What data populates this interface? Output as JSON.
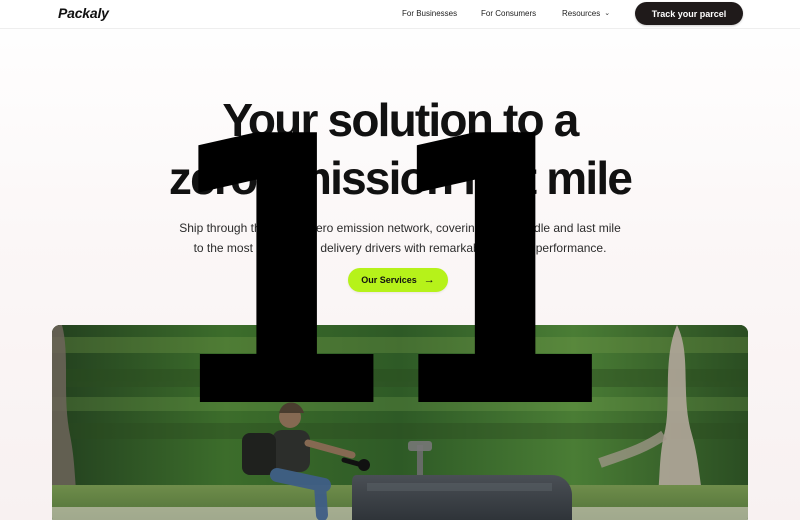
{
  "header": {
    "logo": "Packaly",
    "nav": {
      "for_businesses": "For Businesses",
      "for_consumers": "For Consumers",
      "resources": "Resources"
    },
    "track_button": "Track your parcel"
  },
  "hero": {
    "title_line1": "Your solution to a",
    "title_line2": "zero emission last mile",
    "subtitle_line1": "Ship through the largest zero emission network, covering first - middle and last mile",
    "subtitle_line2": "to the most sustainable delivery drivers with remarkable on-time performance.",
    "cta": "Our Services"
  },
  "overlay": {
    "text": "11"
  },
  "icons": {
    "resources_chevron": "chevron-down-icon",
    "cta_arrow": "arrow-right-icon"
  },
  "colors": {
    "accent_green": "#b6f21a",
    "dark_button": "#1f1a1a",
    "text_dark": "#111111"
  }
}
